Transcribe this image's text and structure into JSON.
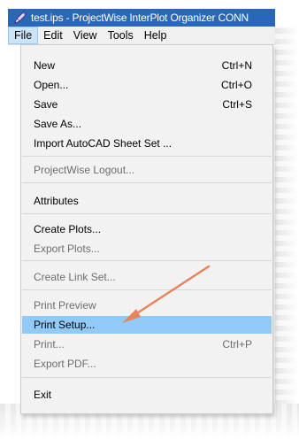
{
  "window": {
    "title": "test.ips - ProjectWise InterPlot Organizer CONN"
  },
  "menubar": {
    "items": [
      "File",
      "Edit",
      "View",
      "Tools",
      "Help"
    ],
    "active": "File"
  },
  "file_menu": {
    "new": {
      "label": "New",
      "shortcut": "Ctrl+N"
    },
    "open": {
      "label": "Open...",
      "shortcut": "Ctrl+O"
    },
    "save": {
      "label": "Save",
      "shortcut": "Ctrl+S"
    },
    "save_as": {
      "label": "Save As..."
    },
    "import_autocad": {
      "label": "Import AutoCAD Sheet Set ..."
    },
    "pw_logout": {
      "label": "ProjectWise Logout..."
    },
    "attributes": {
      "label": "Attributes"
    },
    "create_plots": {
      "label": "Create Plots..."
    },
    "export_plots": {
      "label": "Export Plots..."
    },
    "create_link_set": {
      "label": "Create Link Set..."
    },
    "print_preview": {
      "label": "Print Preview"
    },
    "print_setup": {
      "label": "Print Setup..."
    },
    "print": {
      "label": "Print...",
      "shortcut": "Ctrl+P"
    },
    "export_pdf": {
      "label": "Export PDF..."
    },
    "exit": {
      "label": "Exit"
    }
  },
  "colors": {
    "titlebar": "#2b67b7",
    "highlight": "#91c9f7",
    "arrow": "#e8835b"
  }
}
